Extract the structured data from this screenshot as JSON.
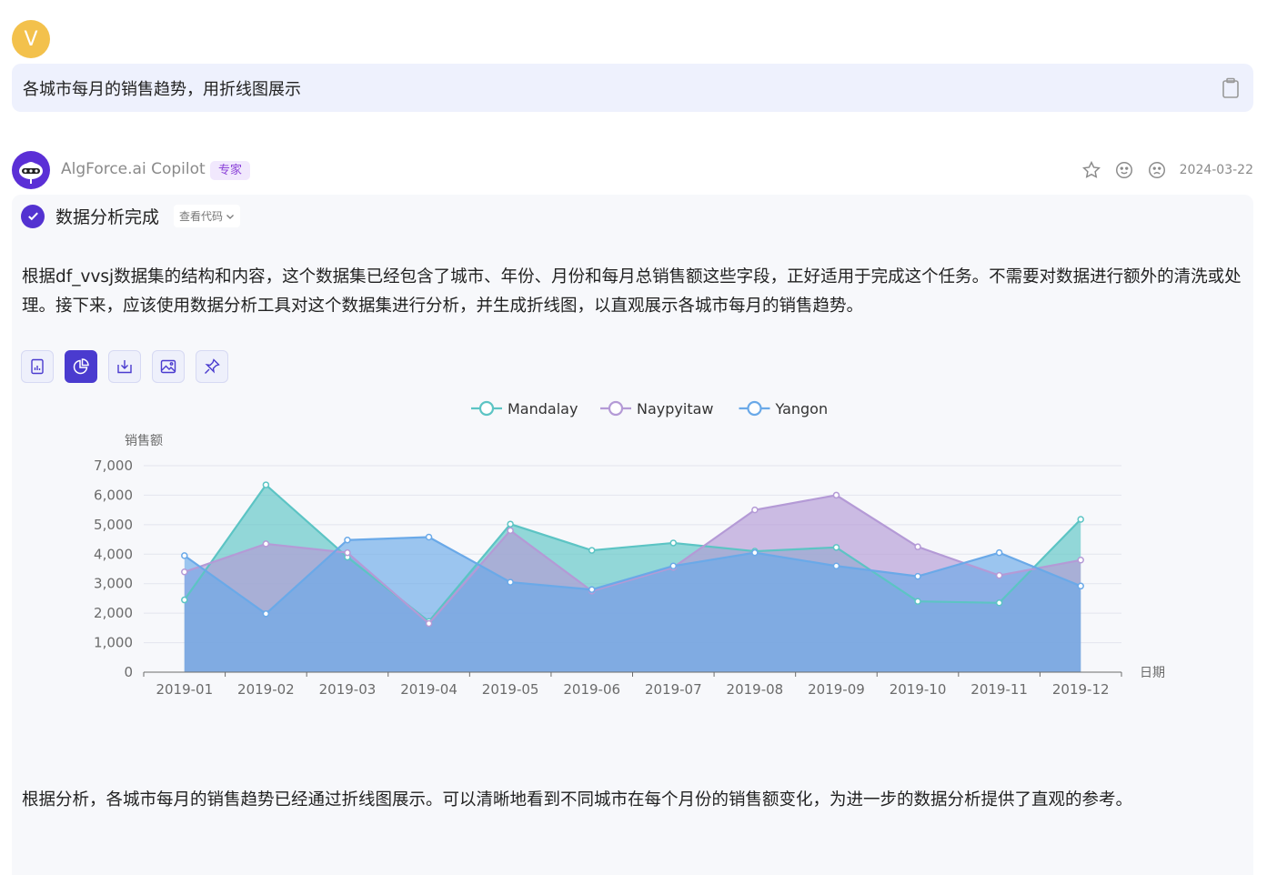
{
  "user": {
    "avatar_letter": "V",
    "message": "各城市每月的销售趋势，用折线图展示"
  },
  "bot": {
    "name": "AlgForce.ai Copilot",
    "badge": "专家",
    "date": "2024-03-22",
    "status": "数据分析完成",
    "view_code": "查看代码",
    "intro": "根据df_vvsj数据集的结构和内容，这个数据集已经包含了城市、年份、月份和每月总销售额这些字段，正好适用于完成这个任务。不需要对数据进行额外的清洗或处理。接下来，应该使用数据分析工具对这个数据集进行分析，并生成折线图，以直观展示各城市每月的销售趋势。",
    "conclusion": "根据分析，各城市每月的销售趋势已经通过折线图展示。可以清晰地看到不同城市在每个月份的销售额变化，为进一步的数据分析提供了直观的参考。"
  },
  "toolbar": {
    "buttons": [
      "report-icon",
      "pie-chart-icon",
      "download-icon",
      "image-icon",
      "pin-icon"
    ],
    "active_index": 1
  },
  "colors": {
    "accent": "#4a3bcf",
    "mandalay": "#5cc4c4",
    "naypyitaw": "#b49ad6",
    "yangon": "#6aa9e8"
  },
  "chart_data": {
    "type": "area",
    "ylabel": "销售额",
    "xlabel": "日期",
    "ylim": [
      0,
      7000
    ],
    "yticks": [
      "0",
      "1,000",
      "2,000",
      "3,000",
      "4,000",
      "5,000",
      "6,000",
      "7,000"
    ],
    "legend_position": "top-center",
    "grid": true,
    "categories": [
      "2019-01",
      "2019-02",
      "2019-03",
      "2019-04",
      "2019-05",
      "2019-06",
      "2019-07",
      "2019-08",
      "2019-09",
      "2019-10",
      "2019-11",
      "2019-12"
    ],
    "series": [
      {
        "name": "Mandalay",
        "color": "#5cc4c4",
        "values": [
          2450,
          6350,
          3900,
          1720,
          5020,
          4130,
          4380,
          4100,
          4230,
          2400,
          2350,
          5180
        ]
      },
      {
        "name": "Naypyitaw",
        "color": "#b49ad6",
        "values": [
          3400,
          4350,
          4050,
          1650,
          4800,
          2750,
          3550,
          5500,
          6000,
          4250,
          3280,
          3800
        ]
      },
      {
        "name": "Yangon",
        "color": "#6aa9e8",
        "values": [
          3950,
          1980,
          4480,
          4580,
          3050,
          2800,
          3600,
          4050,
          3600,
          3250,
          4050,
          2920
        ]
      }
    ]
  }
}
